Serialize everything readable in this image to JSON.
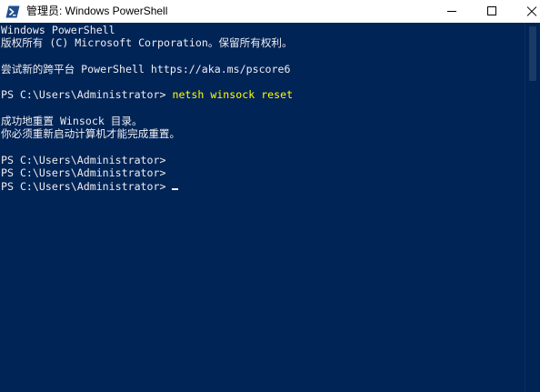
{
  "window": {
    "title": "管理员: Windows PowerShell"
  },
  "icons": {
    "app": "powershell-icon",
    "minimize": "minimize-icon",
    "maximize": "maximize-icon",
    "close": "close-icon"
  },
  "colors": {
    "background": "#012456",
    "text": "#EEEDF0",
    "command": "#FFFF00",
    "titlebar": "#FFFFFF",
    "title_text": "#000000"
  },
  "console": {
    "lines": [
      {
        "text": "Windows PowerShell"
      },
      {
        "text": "版权所有 (C) Microsoft Corporation。保留所有权利。"
      },
      {},
      {
        "text": "尝试新的跨平台 PowerShell https://aka.ms/pscore6"
      },
      {},
      {
        "prompt": "PS C:\\Users\\Administrator> ",
        "command": "netsh winsock reset"
      },
      {},
      {
        "text": "成功地重置 Winsock 目录。"
      },
      {
        "text": "你必须重新启动计算机才能完成重置。"
      },
      {},
      {
        "prompt": "PS C:\\Users\\Administrator>"
      },
      {
        "prompt": "PS C:\\Users\\Administrator>"
      },
      {
        "prompt": "PS C:\\Users\\Administrator> ",
        "cursor": true
      }
    ]
  }
}
